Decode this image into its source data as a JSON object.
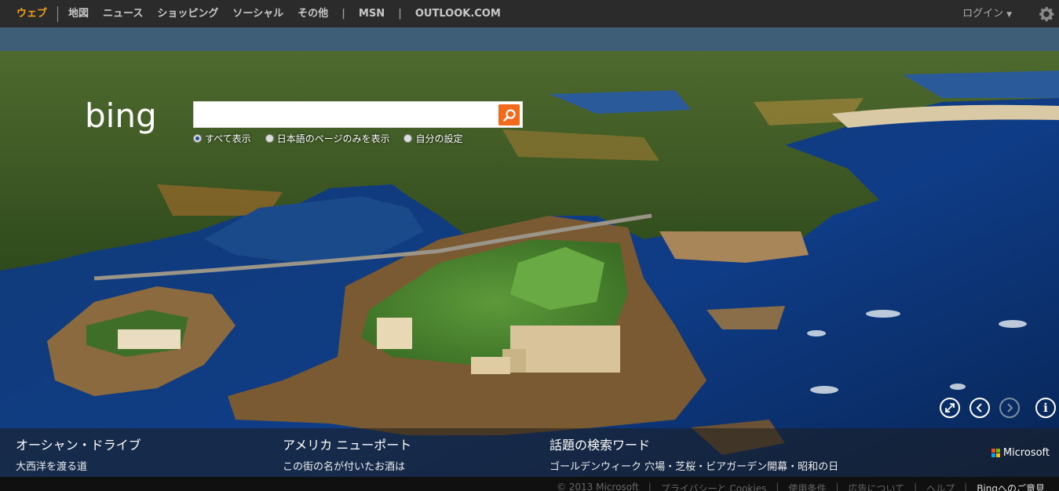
{
  "nav": {
    "tabs": [
      "ウェブ",
      "地図",
      "ニュース",
      "ショッピング",
      "ソーシャル",
      "その他"
    ],
    "pipe1": "|",
    "msn": "MSN",
    "pipe2": "|",
    "outlook": "OUTLOOK.COM",
    "login": "ログイン",
    "settings_icon": "gear-icon"
  },
  "search": {
    "logo": "bing",
    "query": "",
    "scope": [
      "すべて表示",
      "日本語のページのみを表示",
      "自分の設定"
    ],
    "selected_scope": "すべて表示",
    "button_icon": "search-icon"
  },
  "controls": {
    "expand_icon": "expand-icon",
    "prev_icon": "chevron-left-icon",
    "next_icon": "chevron-right-icon",
    "info_icon": "info-icon"
  },
  "hotspots": [
    {
      "title": "オーシャン・ドライブ",
      "subtitle": "大西洋を渡る道"
    },
    {
      "title": "アメリカ ニューポート",
      "subtitle": "この街の名が付いたお酒は"
    },
    {
      "title": "話題の検索ワード",
      "subtitle": "ゴールデンウィーク 穴場・芝桜・ビアガーデン開幕・昭和の日"
    }
  ],
  "brand": "Microsoft",
  "footer": {
    "copyright": "© 2013 Microsoft",
    "privacy": "プライバシーと Cookies",
    "terms": "使用条件",
    "ads": "広告について",
    "help": "ヘルプ",
    "feedback": "Bingへのご意見"
  },
  "colors": {
    "active_tab": "#f4a01e",
    "search_button": "#f26a1b",
    "topbar": "#2b2b2b"
  }
}
